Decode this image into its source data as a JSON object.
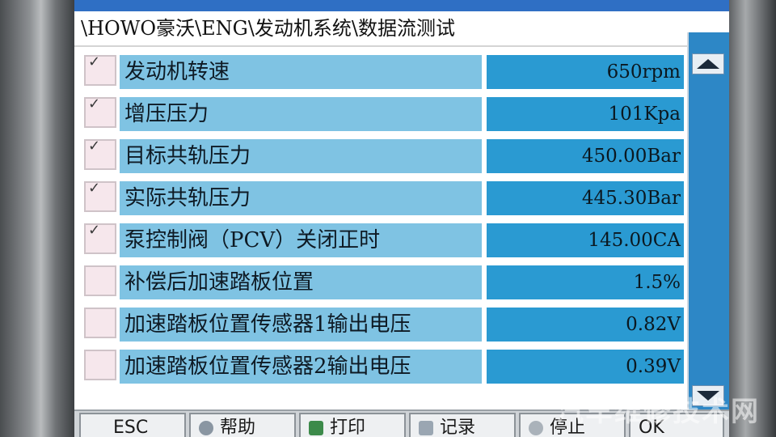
{
  "breadcrumb": "\\HOWO豪沃\\ENG\\发动机系统\\数据流测试",
  "rows": [
    {
      "name": "发动机转速",
      "value": "650rpm",
      "checked": true
    },
    {
      "name": "增压压力",
      "value": "101Kpa",
      "checked": true
    },
    {
      "name": "目标共轨压力",
      "value": "450.00Bar",
      "checked": true
    },
    {
      "name": "实际共轨压力",
      "value": "445.30Bar",
      "checked": true
    },
    {
      "name": "泵控制阀（PCV）关闭正时",
      "value": "145.00CA",
      "checked": true
    },
    {
      "name": "补偿后加速踏板位置",
      "value": "1.5%",
      "checked": false
    },
    {
      "name": "加速踏板位置传感器1输出电压",
      "value": "0.82V",
      "checked": false
    },
    {
      "name": "加速踏板位置传感器2输出电压",
      "value": "0.39V",
      "checked": false
    }
  ],
  "check_mark": "✓",
  "buttons": {
    "esc": "ESC",
    "help": "帮助",
    "print": "打印",
    "record": "记录",
    "stop": "停止",
    "ok": "OK"
  },
  "watermark": "汽车维修技术网",
  "colors": {
    "name_cell": "#7fc3e3",
    "value_cell": "#2a9ad2",
    "checkbox": "#f6e7ec",
    "scrollbar": "#2d87c6"
  },
  "icons": {
    "scroll_up": "triangle-up-icon",
    "scroll_down": "triangle-down-icon",
    "check": "check-icon"
  }
}
